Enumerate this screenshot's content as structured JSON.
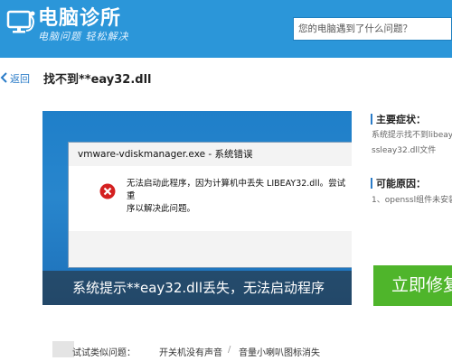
{
  "header": {
    "brand_title": "电脑诊所",
    "brand_slogan": "电脑问题 轻松解决",
    "search_placeholder": "您的电脑遇到了什么问题？",
    "logo_icon": "monitor-stethoscope-icon"
  },
  "nav": {
    "back_label": "返回",
    "page_title": "找不到**eay32.dll"
  },
  "screenshot": {
    "dialog_title": "vmware-vdiskmanager.exe - 系统错误",
    "error_line1": "无法启动此程序，因为计算机中丢失 LIBEAY32.dll。尝试重",
    "error_line2": "序以解决此问题。",
    "caption": "系统提示**eay32.dll丢失，无法启动程序",
    "error_icon": "error-x-icon"
  },
  "sidebar": {
    "symptom_heading": "主要症状：",
    "symptom_line1": "系统提示找不到libeay",
    "symptom_line2": "ssleay32.dll文件",
    "cause_heading": "可能原因：",
    "cause_line1": "1、openssl组件未安装",
    "fix_button": "立即修复"
  },
  "bottom": {
    "try_label": "试试类似问题：",
    "links": [
      "开关机没有声音",
      "音量小喇叭图标消失"
    ],
    "separator": "/"
  },
  "colors": {
    "header_bg": "#2b96d9",
    "accent_link": "#2b7cc8",
    "fix_button_bg": "#4fb52b",
    "error_red": "#d42020"
  }
}
